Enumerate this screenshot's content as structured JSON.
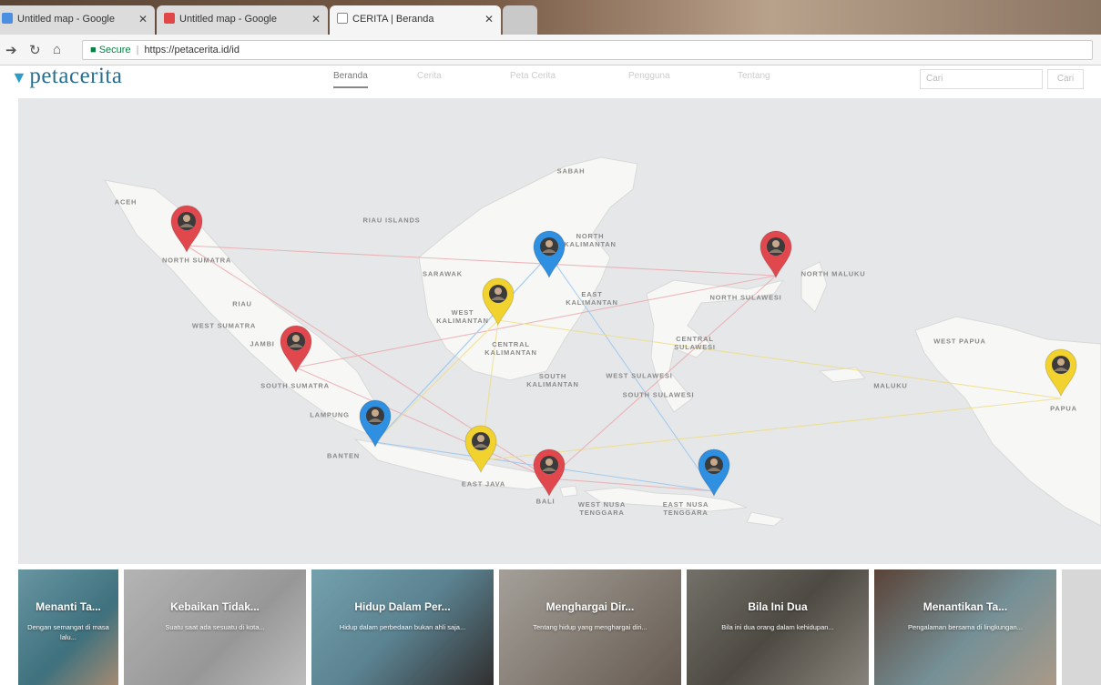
{
  "browser": {
    "tabs": [
      {
        "title": "Untitled map - Google",
        "active": false
      },
      {
        "title": "Untitled map - Google",
        "active": false
      },
      {
        "title": "CERITA | Beranda",
        "active": true
      }
    ],
    "url": {
      "secure_label": "Secure",
      "address": "https://petacerita.id/id"
    }
  },
  "site": {
    "logo_text": "petacerita",
    "nav": [
      "Beranda",
      "Cerita",
      "Peta Cerita",
      "Pengguna",
      "Tentang"
    ],
    "search_placeholder": "Cari",
    "search_button": "Cari"
  },
  "map": {
    "region_labels": [
      {
        "text": "ACEH"
      },
      {
        "text": "NORTH SUMATRA"
      },
      {
        "text": "RIAU ISLANDS"
      },
      {
        "text": "RIAU"
      },
      {
        "text": "WEST SUMATRA"
      },
      {
        "text": "JAMBI"
      },
      {
        "text": "SOUTH SUMATRA"
      },
      {
        "text": "LAMPUNG"
      },
      {
        "text": "BANTEN"
      },
      {
        "text": "SABAH"
      },
      {
        "text": "SARAWAK"
      },
      {
        "text": "NORTH\nKALIMANTAN"
      },
      {
        "text": "WEST\nKALIMANTAN"
      },
      {
        "text": "EAST\nKALIMANTAN"
      },
      {
        "text": "CENTRAL\nKALIMANTAN"
      },
      {
        "text": "SOUTH\nKALIMANTAN"
      },
      {
        "text": "EAST JAVA"
      },
      {
        "text": "BALI"
      },
      {
        "text": "WEST NUSA\nTENGGARA"
      },
      {
        "text": "EAST NUSA\nTENGGARA"
      },
      {
        "text": "WEST SULAWESI"
      },
      {
        "text": "SOUTH SULAWESI"
      },
      {
        "text": "CENTRAL\nSULAWESI"
      },
      {
        "text": "NORTH SULAWESI"
      },
      {
        "text": "NORTH MALUKU"
      },
      {
        "text": "MALUKU"
      },
      {
        "text": "WEST PAPUA"
      },
      {
        "text": "PAPUA"
      }
    ],
    "pins": [
      {
        "color": "#e0484e",
        "location": "North Sumatra"
      },
      {
        "color": "#e0484e",
        "location": "Jambi"
      },
      {
        "color": "#2f8fe0",
        "location": "Lampung"
      },
      {
        "color": "#f2d22e",
        "location": "West Kalimantan"
      },
      {
        "color": "#2f8fe0",
        "location": "North Kalimantan"
      },
      {
        "color": "#e0484e",
        "location": "North Maluku"
      },
      {
        "color": "#f2d22e",
        "location": "East Java"
      },
      {
        "color": "#e0484e",
        "location": "Bali"
      },
      {
        "color": "#2f8fe0",
        "location": "East Nusa Tenggara"
      },
      {
        "color": "#f2d22e",
        "location": "Papua"
      }
    ]
  },
  "stories": [
    {
      "title": "Menanti Ta...",
      "desc": "Dengan semangat di\nmasa lalu..."
    },
    {
      "title": "Kebaikan Tidak...",
      "desc": "Suatu saat ada sesuatu di\nkota..."
    },
    {
      "title": "Hidup Dalam Per...",
      "desc": "Hidup dalam perbedaan bukan ahli\nsaja..."
    },
    {
      "title": "Menghargai Dir...",
      "desc": "Tentang hidup yang menghargai\ndiri..."
    },
    {
      "title": "Bila Ini Dua",
      "desc": "Bila ini dua orang dalam\nkehidupan..."
    },
    {
      "title": "Menantikan Ta...",
      "desc": "Pengalaman bersama di\nlingkungan..."
    }
  ]
}
